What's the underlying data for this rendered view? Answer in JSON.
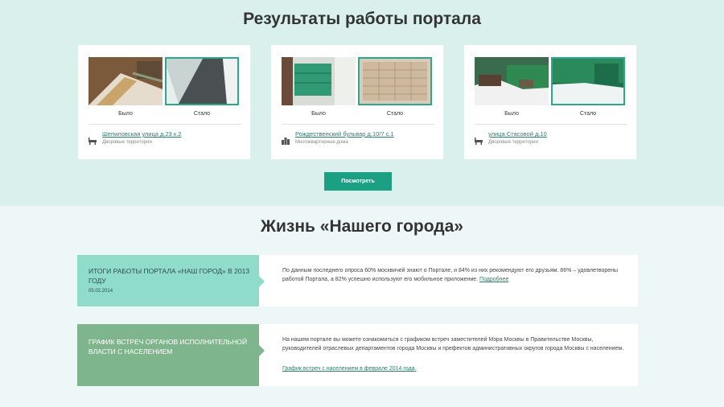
{
  "results": {
    "title": "Результаты работы портала",
    "before_label": "Было",
    "after_label": "Стало",
    "cards": [
      {
        "link": "Шепиловская улица д.23 к.2",
        "category": "Дворовые территории",
        "icon": "yard-icon"
      },
      {
        "link": "Рождественский бульвар д.10/7 с.1",
        "category": "Многоквартирные дома",
        "icon": "building-icon"
      },
      {
        "link": "улица Стасовой д.10",
        "category": "Дворовые территории",
        "icon": "yard-icon"
      }
    ],
    "button": "Посмотреть"
  },
  "life": {
    "title": "Жизнь «Нашего города»",
    "news": [
      {
        "heading": "ИТОГИ РАБОТЫ ПОРТАЛА «НАШ ГОРОД» В 2013 ГОДУ",
        "date": "05.02.2014",
        "text": "По данным последнего опроса 60% москвичей знают о Портале, и 84% из них рекомендуют его друзьям. 86% – удовлетворены работой Портала, а 82% успешно используют его мобильное приложение.",
        "more": "Подробнее"
      },
      {
        "heading": "ГРАФИК ВСТРЕЧ ОРГАНОВ ИСПОЛНИТЕЛЬНОЙ ВЛАСТИ С НАСЕЛЕНИЕМ",
        "text": "На нашем портале вы можете ознакомиться с графиком встреч заместителей Мэра Москвы в Правительстве Москвы, руководителей отраслевых департаментов города Москвы и префектов административных округов города Москвы с населением.",
        "link": "График встреч с населением в феврале 2014 года."
      }
    ]
  },
  "colors": {
    "accent": "#1ca084",
    "top_band": "#daf0ec",
    "news1": "#8fdccb",
    "news2": "#7fb58c"
  }
}
